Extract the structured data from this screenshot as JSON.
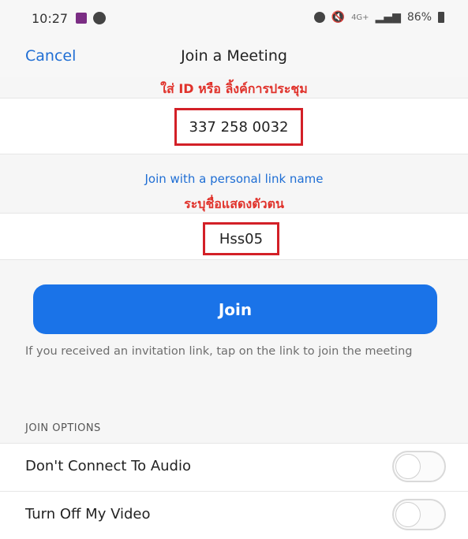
{
  "status_bar": {
    "time": "10:27",
    "battery": "86%",
    "network": "4G+"
  },
  "nav": {
    "cancel_label": "Cancel",
    "title": "Join a Meeting"
  },
  "annotations": {
    "id_hint": "ใส่ ID หรือ ลิ้งค์การประชุม",
    "name_hint": "ระบุชื่อแสดงตัวตน",
    "color": "#e0322b"
  },
  "meeting_id_field": {
    "value": "337 258 0032"
  },
  "personal_link_label": "Join with a personal link name",
  "display_name_field": {
    "value": "Hss05"
  },
  "join_button": {
    "label": "Join",
    "color": "#1a73e8"
  },
  "invitation_hint": "If you received an invitation link, tap on the link to join the meeting",
  "join_options": {
    "header": "JOIN OPTIONS",
    "items": [
      {
        "label": "Don't Connect To Audio",
        "enabled": false
      },
      {
        "label": "Turn Off My Video",
        "enabled": false
      }
    ]
  }
}
